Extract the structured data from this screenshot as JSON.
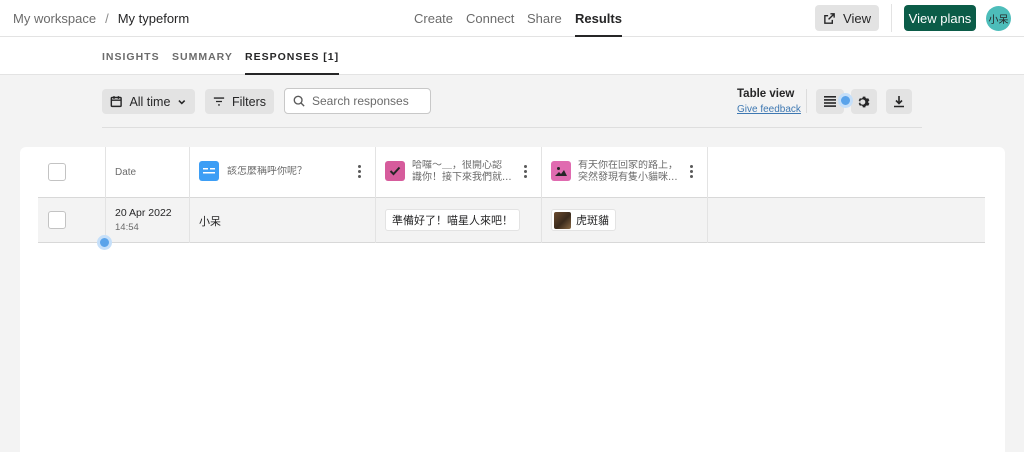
{
  "breadcrumb": {
    "workspace": "My workspace",
    "separator": "/",
    "form": "My typeform"
  },
  "nav": {
    "create": "Create",
    "connect": "Connect",
    "share": "Share",
    "results": "Results"
  },
  "header_actions": {
    "view_label": "View",
    "plans_label": "View plans",
    "avatar_text": "小呆"
  },
  "tabs": {
    "insights": "INSIGHTS",
    "summary": "SUMMARY",
    "responses": "RESPONSES [1]"
  },
  "toolbar": {
    "time_filter": "All time",
    "filters_label": "Filters",
    "search_placeholder": "Search responses",
    "table_view_title": "Table view",
    "feedback_link": "Give feedback"
  },
  "table": {
    "date_header": "Date",
    "questions": [
      {
        "text": "該怎麼稱呼你呢？",
        "icon": "short-text-icon",
        "color": "#3d9ef5"
      },
      {
        "text_line1": "哈囉～＿，很開心認",
        "text_line2": "識你！接下來我們就...",
        "icon": "checkmark-icon",
        "color": "#d65c9c"
      },
      {
        "text_line1": "有天你在回家的路上，",
        "text_line2": "突然發現有隻小貓咪...",
        "icon": "picture-choice-icon",
        "color": "#e06bb0"
      }
    ],
    "rows": [
      {
        "date": "20 Apr 2022",
        "time": "14:54",
        "name": "小呆",
        "answer_choice": "準備好了！喵星人來吧！",
        "answer_picture": "虎斑貓"
      }
    ]
  }
}
